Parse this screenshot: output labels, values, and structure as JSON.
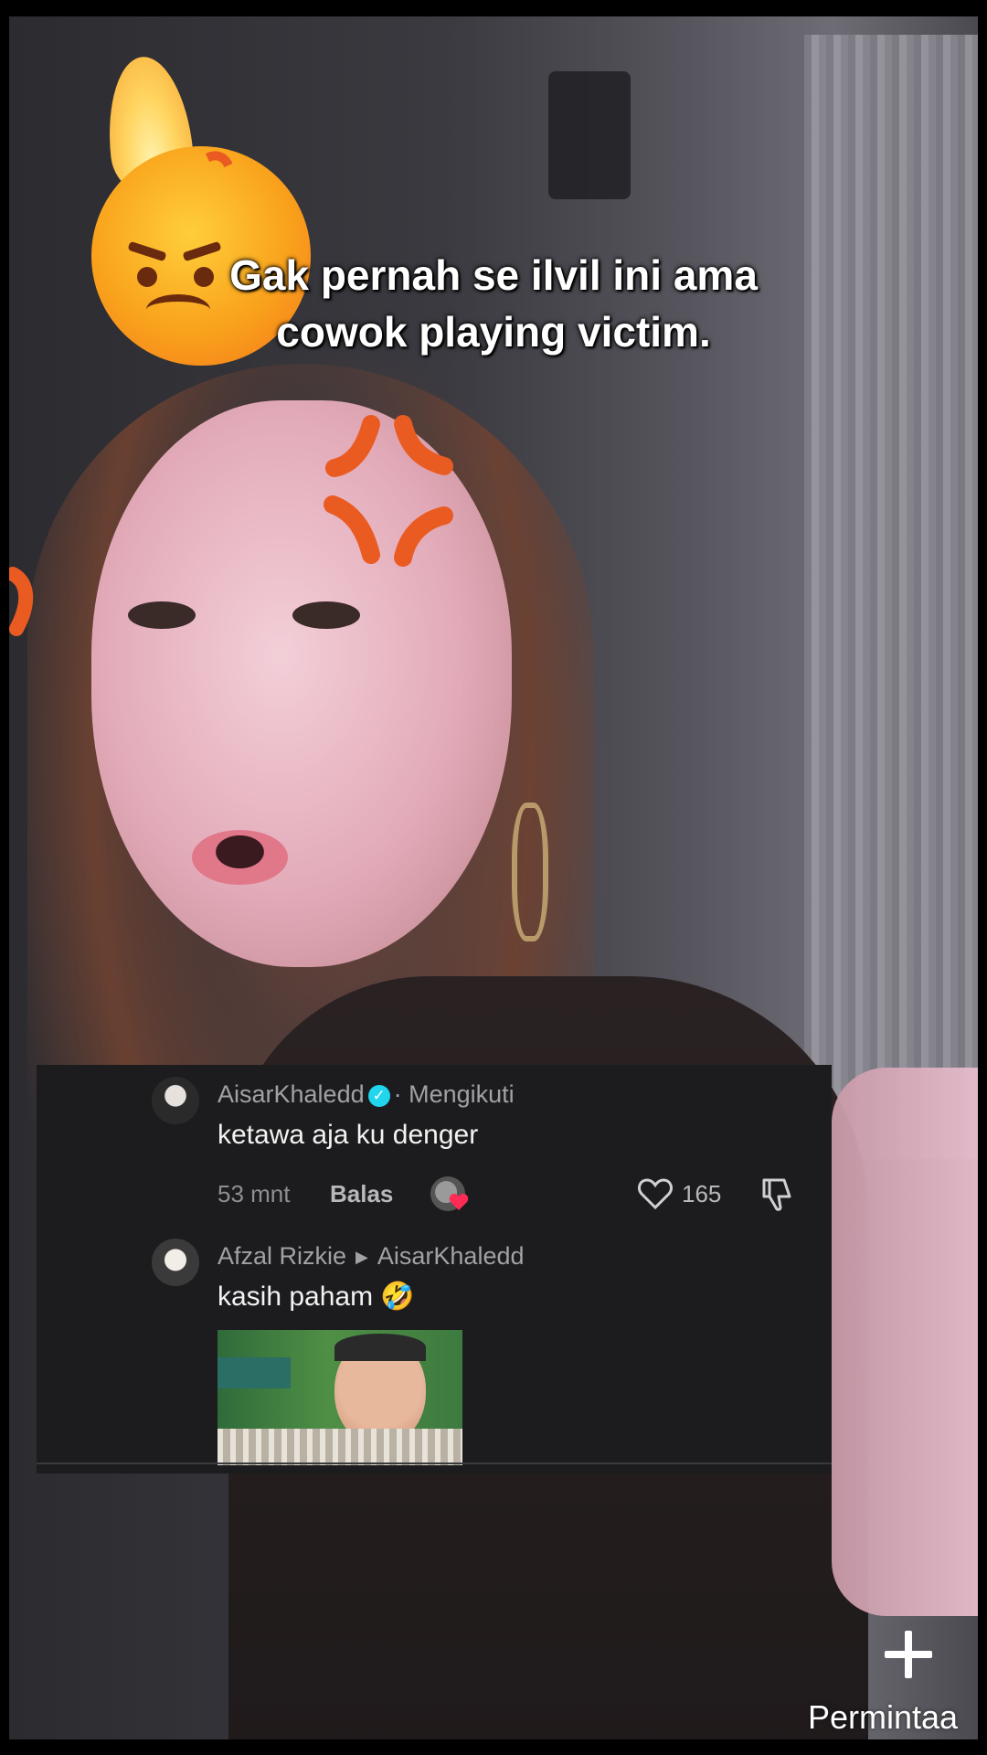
{
  "caption": {
    "line1": "Gak pernah se ilvil ini ama",
    "line2": "cowok playing victim."
  },
  "stickers": [
    "angry-face-with-flame-emoji",
    "anger-symbol-emoji"
  ],
  "comments": [
    {
      "username": "AisarKhaledd",
      "verified": true,
      "status": "· Mengikuti",
      "text": "ketawa aja ku denger",
      "time": "53 mnt",
      "reply_label": "Balas",
      "like_count": "165"
    },
    {
      "username": "Afzal Rizkie",
      "reply_to": "AisarKhaledd",
      "text": "kasih paham 🤣",
      "has_image": true
    }
  ],
  "request_button": {
    "label": "Permintaa"
  },
  "colors": {
    "verified": "#20d5ec",
    "panel": "#1c1c1e",
    "heart_badge": "#fe2c55"
  }
}
